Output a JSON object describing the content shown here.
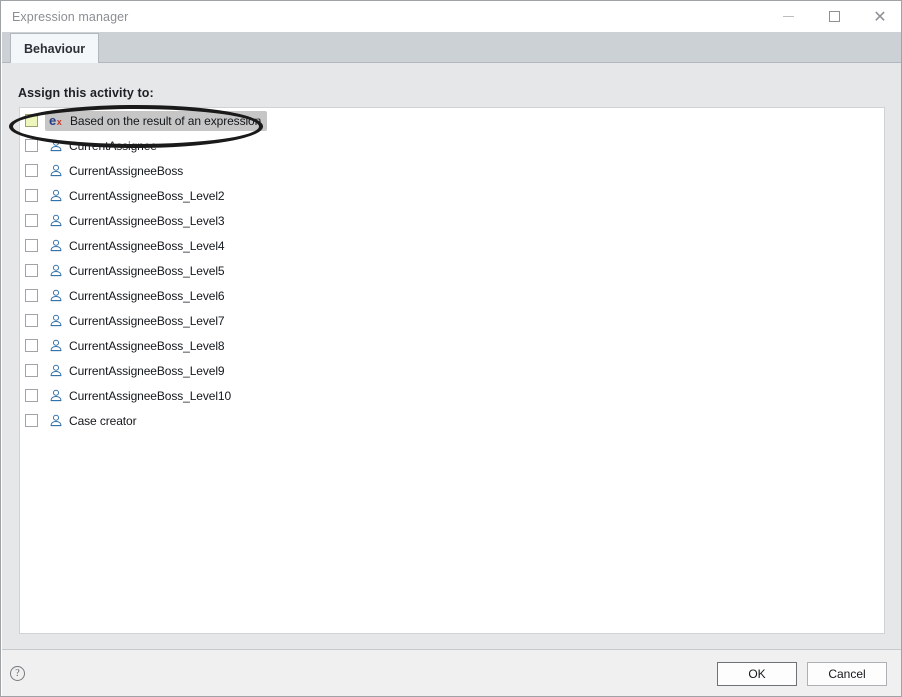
{
  "window": {
    "title": "Expression manager",
    "controls": {
      "minimize": "minimize-icon",
      "maximize": "maximize-icon",
      "close": "✕"
    }
  },
  "tabs": [
    {
      "label": "Behaviour",
      "active": true
    }
  ],
  "main": {
    "section_label": "Assign this activity to:",
    "items": [
      {
        "label": "Based on the result of an expression",
        "icon": "expression-icon",
        "checked": false,
        "selected": true
      },
      {
        "label": "CurrentAssignee",
        "icon": "user-icon",
        "checked": false,
        "selected": false
      },
      {
        "label": "CurrentAssigneeBoss",
        "icon": "user-icon",
        "checked": false,
        "selected": false
      },
      {
        "label": "CurrentAssigneeBoss_Level2",
        "icon": "user-icon",
        "checked": false,
        "selected": false
      },
      {
        "label": "CurrentAssigneeBoss_Level3",
        "icon": "user-icon",
        "checked": false,
        "selected": false
      },
      {
        "label": "CurrentAssigneeBoss_Level4",
        "icon": "user-icon",
        "checked": false,
        "selected": false
      },
      {
        "label": "CurrentAssigneeBoss_Level5",
        "icon": "user-icon",
        "checked": false,
        "selected": false
      },
      {
        "label": "CurrentAssigneeBoss_Level6",
        "icon": "user-icon",
        "checked": false,
        "selected": false
      },
      {
        "label": "CurrentAssigneeBoss_Level7",
        "icon": "user-icon",
        "checked": false,
        "selected": false
      },
      {
        "label": "CurrentAssigneeBoss_Level8",
        "icon": "user-icon",
        "checked": false,
        "selected": false
      },
      {
        "label": "CurrentAssigneeBoss_Level9",
        "icon": "user-icon",
        "checked": false,
        "selected": false
      },
      {
        "label": "CurrentAssigneeBoss_Level10",
        "icon": "user-icon",
        "checked": false,
        "selected": false
      },
      {
        "label": "Case creator",
        "icon": "user-icon",
        "checked": false,
        "selected": false
      }
    ]
  },
  "footer": {
    "help_label": "?",
    "ok_label": "OK",
    "cancel_label": "Cancel"
  },
  "annotation": {
    "type": "ellipse-highlight",
    "target": "Based on the result of an expression"
  },
  "colors": {
    "tabstrip": "#ccd1d6",
    "panel_bg": "#e5e7e8",
    "list_bg": "#ffffff",
    "selection": "#c6c6c6",
    "checkbox_highlight": "#eef6bb",
    "user_icon": "#2f6fa8",
    "expression_e": "#2b3d82",
    "expression_x": "#c0392b",
    "annotation": "#1a1a1a"
  }
}
